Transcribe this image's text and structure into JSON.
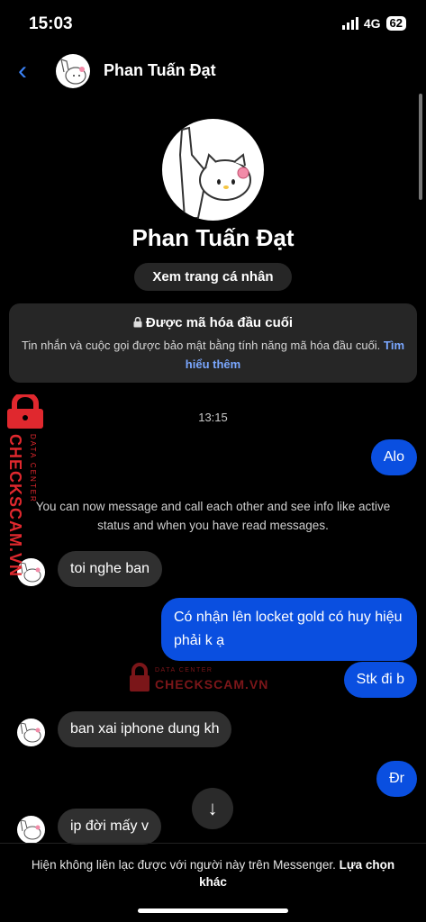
{
  "status": {
    "time": "15:03",
    "network": "4G",
    "battery": "62"
  },
  "header": {
    "contact_name": "Phan Tuấn Đạt"
  },
  "profile": {
    "name": "Phan Tuấn Đạt",
    "view_profile_label": "Xem trang cá nhân"
  },
  "encryption": {
    "title": "Được mã hóa đầu cuối",
    "description": "Tin nhắn và cuộc gọi được bảo mật bằng tính năng mã hóa đầu cuối.",
    "link": "Tìm hiểu thêm"
  },
  "chat": {
    "timestamp": "13:15",
    "system_message": "You can now message and call each other and see info like active status and when you have read messages.",
    "messages": [
      {
        "direction": "out",
        "text": "Alo"
      },
      {
        "direction": "in",
        "text": "toi nghe ban"
      },
      {
        "direction": "out",
        "text": "Có nhận lên locket gold có huy hiệu phải k ạ"
      },
      {
        "direction": "out",
        "text": "Stk đi b"
      },
      {
        "direction": "in",
        "text": "ban xai iphone dung kh"
      },
      {
        "direction": "out",
        "text": "Đr"
      },
      {
        "direction": "in",
        "text": "ip đời mấy v"
      }
    ]
  },
  "watermark": {
    "brand": "CHECKSCAM.VN",
    "tagline": "DATA CENTER"
  },
  "footer": {
    "text": "Hiện không liên lạc được với người này trên Messenger.",
    "link": "Lựa chọn khác"
  },
  "icons": {
    "back": "chevron-left-icon",
    "lock": "lock-icon",
    "scroll_down": "arrow-down-icon"
  },
  "colors": {
    "accent": "#3b82f6",
    "outgoing_bubble": "#0a4fe0",
    "incoming_bubble": "#303030",
    "watermark": "#e0282e"
  }
}
